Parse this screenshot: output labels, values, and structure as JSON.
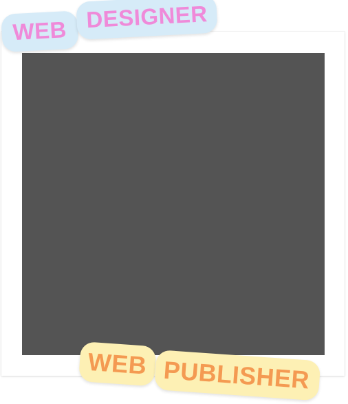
{
  "stickers": {
    "top": {
      "word1": "WEB",
      "word2": "DESIGNER",
      "background": "#d6ebf8",
      "text_color": "#ef8ad9"
    },
    "bottom": {
      "word1": "WEB",
      "word2": "PUBLISHER",
      "background": "#fdf0b4",
      "text_color": "#f49a52"
    }
  },
  "photo": {
    "placeholder_color": "#545454"
  }
}
